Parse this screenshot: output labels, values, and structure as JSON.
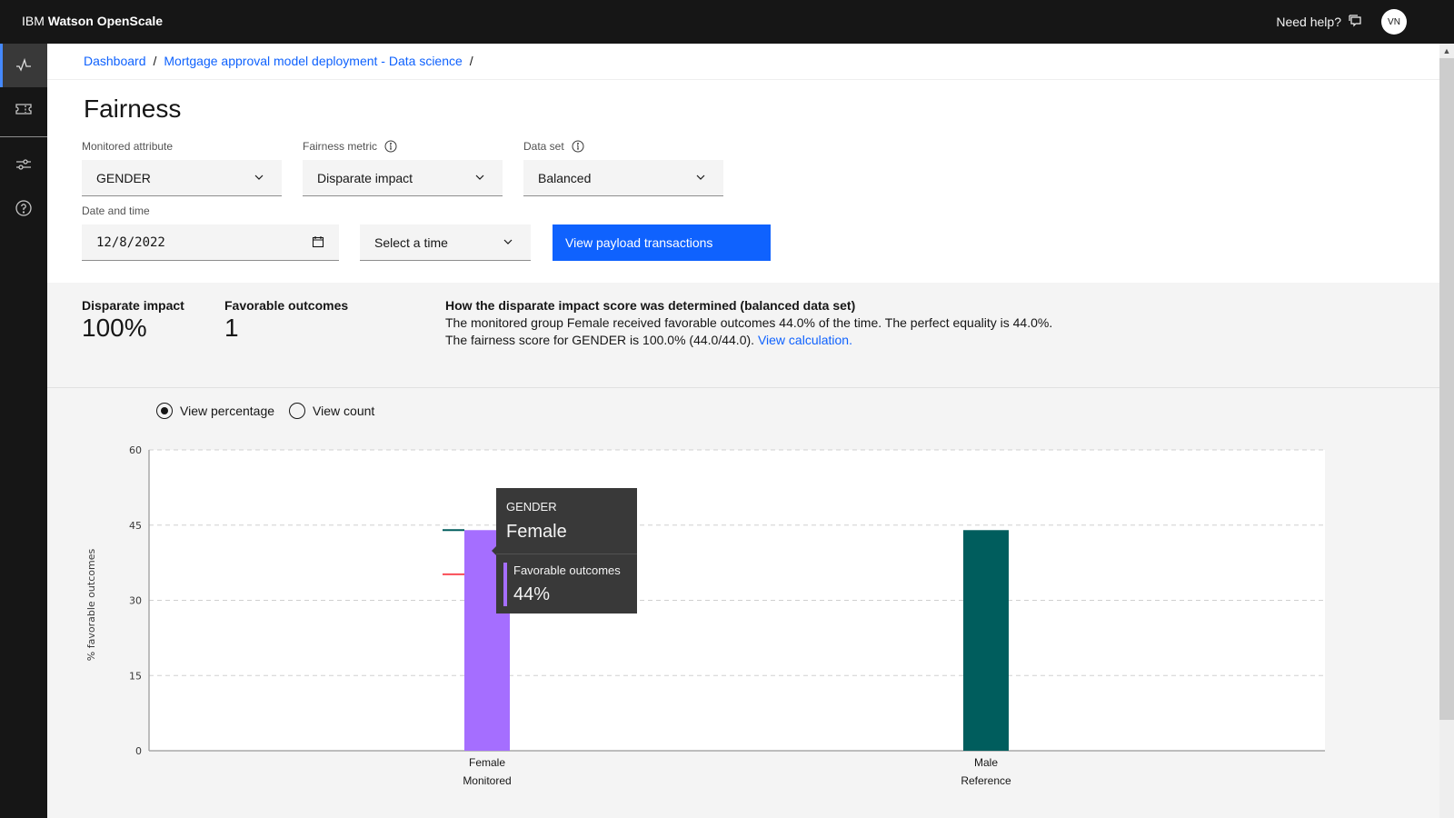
{
  "app": {
    "brand_prefix": "IBM",
    "brand_name": "Watson OpenScale",
    "help_label": "Need help?",
    "user_initials": "VN"
  },
  "sidenav": {
    "items": [
      {
        "name": "monitor",
        "icon": "activity-icon",
        "active": true
      },
      {
        "name": "catalog",
        "icon": "ticket-icon",
        "active": false
      },
      {
        "name": "configure",
        "icon": "sliders-icon",
        "active": false
      },
      {
        "name": "help",
        "icon": "help-circle-icon",
        "active": false
      }
    ]
  },
  "breadcrumb": {
    "items": [
      "Dashboard",
      "Mortgage approval model deployment - Data science"
    ],
    "separator": "/"
  },
  "page": {
    "title": "Fairness"
  },
  "filters": {
    "monitored_attribute": {
      "label": "Monitored attribute",
      "value": "GENDER"
    },
    "fairness_metric": {
      "label": "Fairness metric",
      "value": "Disparate impact"
    },
    "data_set": {
      "label": "Data set",
      "value": "Balanced"
    },
    "date_time": {
      "label": "Date and time",
      "date_value": "12/8/2022",
      "time_placeholder": "Select a time"
    },
    "view_payload_label": "View payload transactions"
  },
  "summary": {
    "disparate_impact": {
      "label": "Disparate impact",
      "value": "100%"
    },
    "favorable_outcomes": {
      "label": "Favorable outcomes",
      "value": "1"
    },
    "explanation": {
      "title": "How the disparate impact score was determined (balanced data set)",
      "line1": "The monitored group Female received favorable outcomes 44.0% of the time. The perfect equality is 44.0%.",
      "line2": "The fairness score for GENDER is 100.0% (44.0/44.0).",
      "link": "View calculation."
    }
  },
  "view_toggle": {
    "options": [
      "View percentage",
      "View count"
    ],
    "selected": "View percentage"
  },
  "tooltip": {
    "category_label": "GENDER",
    "category_value": "Female",
    "metric_label": "Favorable outcomes",
    "metric_value": "44%"
  },
  "colors": {
    "monitored": "#a56eff",
    "reference": "#005d5d",
    "threshold": "#fa4d56",
    "primary": "#0f62fe"
  },
  "chart_data": {
    "type": "bar",
    "categories": [
      "Female",
      "Male"
    ],
    "category_groups": [
      "Monitored",
      "Reference"
    ],
    "values": [
      44,
      44
    ],
    "ylabel": "% favorable outcomes",
    "xlabel": "",
    "ylim": [
      0,
      60
    ],
    "yticks": [
      0,
      15,
      30,
      45,
      60
    ],
    "grid": true,
    "markers": [
      {
        "name": "reference-level",
        "value": 44,
        "color": "#005d5d"
      },
      {
        "name": "fairness-threshold",
        "value": 35.2,
        "color": "#fa4d56"
      }
    ]
  }
}
